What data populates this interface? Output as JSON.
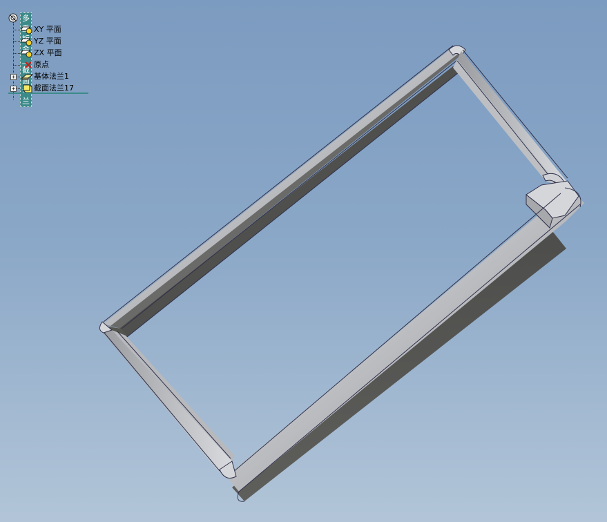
{
  "feature_tree": {
    "root_label": "多重钣金_截面法兰",
    "items": [
      {
        "label": "XY 平面",
        "icon": "plane-icon"
      },
      {
        "label": "YZ 平面",
        "icon": "plane-icon"
      },
      {
        "label": "ZX 平面",
        "icon": "plane-icon"
      },
      {
        "label": "原点",
        "icon": "origin-icon"
      },
      {
        "label": "基体法兰1",
        "icon": "base-flange-icon",
        "expandable": true
      },
      {
        "label": "截面法兰17",
        "icon": "section-flange-icon",
        "expandable": true
      }
    ],
    "expander_symbol": "+"
  },
  "colors": {
    "background_top": "#7c9bc0",
    "background_bottom": "#b2c5d8",
    "selection": "#3c8a8a",
    "part_face_light": "#c8c8cc",
    "part_face_dark": "#5a5a58"
  }
}
